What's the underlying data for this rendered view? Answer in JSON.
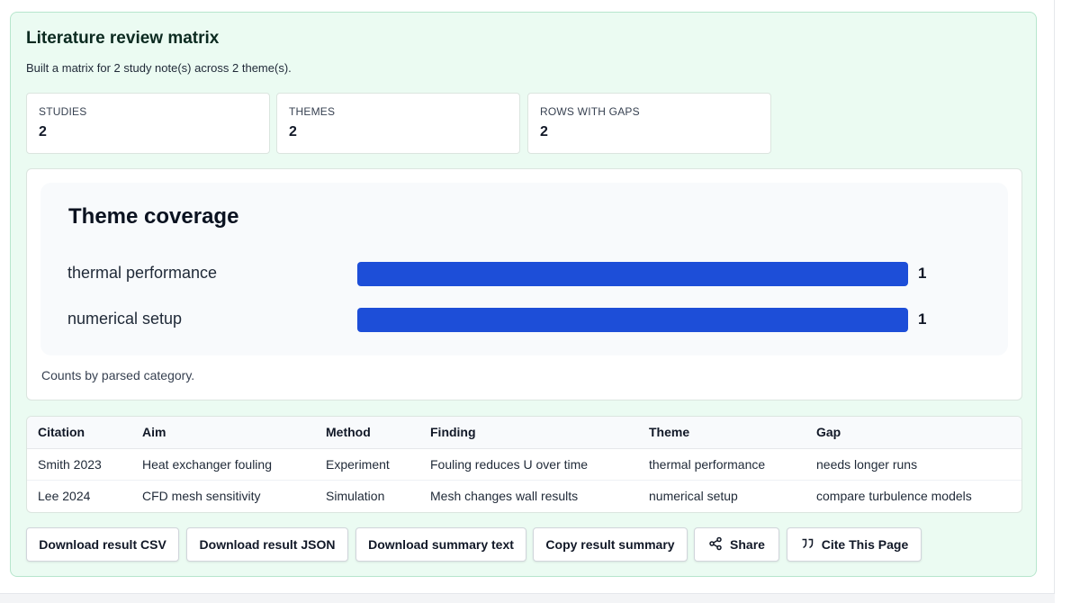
{
  "panel": {
    "title": "Literature review matrix",
    "subtitle": "Built a matrix for 2 study note(s) across 2 theme(s)."
  },
  "stats": [
    {
      "label": "STUDIES",
      "value": "2"
    },
    {
      "label": "THEMES",
      "value": "2"
    },
    {
      "label": "ROWS WITH GAPS",
      "value": "2"
    }
  ],
  "chart_data": {
    "type": "bar",
    "orientation": "horizontal",
    "title": "Theme coverage",
    "categories": [
      "thermal performance",
      "numerical setup"
    ],
    "values": [
      1,
      1
    ],
    "xlim": [
      0,
      1
    ],
    "grid": false,
    "bar_color": "#1d4ed8"
  },
  "chart_note": "Counts by parsed category.",
  "table": {
    "columns": [
      "Citation",
      "Aim",
      "Method",
      "Finding",
      "Theme",
      "Gap"
    ],
    "rows": [
      [
        "Smith 2023",
        "Heat exchanger fouling",
        "Experiment",
        "Fouling reduces U over time",
        "thermal performance",
        "needs longer runs"
      ],
      [
        "Lee 2024",
        "CFD mesh sensitivity",
        "Simulation",
        "Mesh changes wall results",
        "numerical setup",
        "compare turbulence models"
      ]
    ]
  },
  "buttons": {
    "download_csv": "Download result CSV",
    "download_json": "Download result JSON",
    "download_summary": "Download summary text",
    "copy_summary": "Copy result summary",
    "share": "Share",
    "cite": "Cite This Page"
  },
  "icons": {
    "share": "share-icon",
    "cite": "quote-icon"
  },
  "colors": {
    "panel_bg": "#ebfbf2",
    "panel_border": "#b7e6cd",
    "accent_bar": "#1d4ed8"
  }
}
